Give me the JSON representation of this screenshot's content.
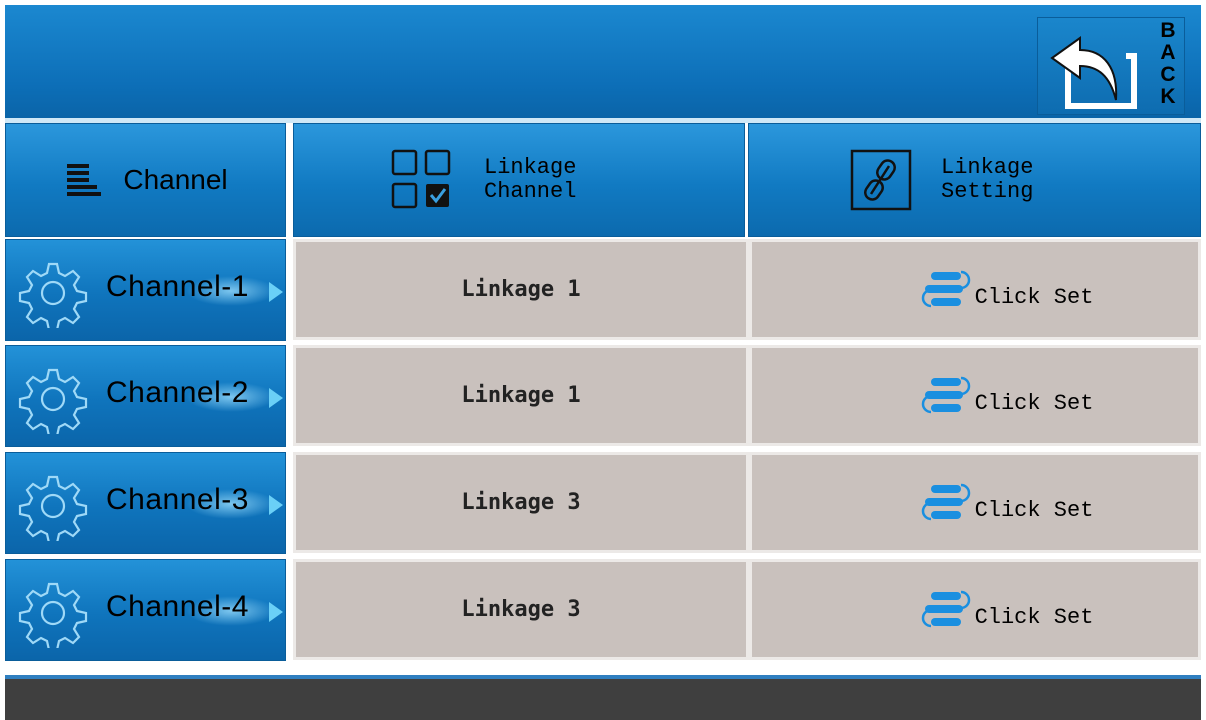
{
  "back_button": {
    "letters": [
      "B",
      "A",
      "C",
      "K"
    ]
  },
  "header": {
    "channel": "Channel",
    "linkage_channel": [
      "Linkage",
      "Channel"
    ],
    "linkage_setting": [
      "Linkage",
      "Setting"
    ]
  },
  "rows": [
    {
      "channel": "Channel-1",
      "linkage": "Linkage 1",
      "setting": "Click Set"
    },
    {
      "channel": "Channel-2",
      "linkage": "Linkage 1",
      "setting": "Click Set"
    },
    {
      "channel": "Channel-3",
      "linkage": "Linkage 3",
      "setting": "Click Set"
    },
    {
      "channel": "Channel-4",
      "linkage": "Linkage 3",
      "setting": "Click Set"
    }
  ],
  "icons": {
    "back": "back-arrow-icon",
    "channel": "list-icon",
    "linkage_channel": "checkbox-grid-icon",
    "linkage_setting": "link-icon",
    "row": "gear-icon",
    "set": "toggle-stack-icon"
  },
  "colors": {
    "accent_blue": "#0f74bc",
    "cell_bg": "#c9c1bd",
    "bottom_bar": "#3f3f3f"
  }
}
